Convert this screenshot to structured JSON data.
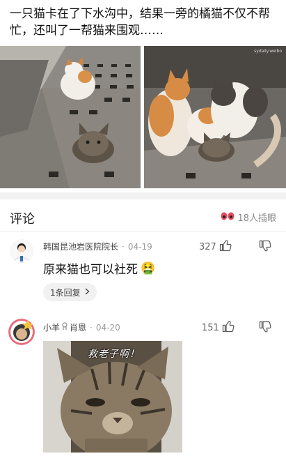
{
  "post": {
    "text": "一只猫卡在了下水沟中，结果一旁的橘猫不仅不帮忙，还叫了一帮猫来围观……",
    "watermark": "sydaily.weibo"
  },
  "comments_section": {
    "title": "评论",
    "views": "18人插眼"
  },
  "comments": [
    {
      "user": "韩国昆池岩医院院长",
      "date": "04-19",
      "likes": "327",
      "text": "原来猫也可以社死",
      "emoji": "🤮",
      "reply_label": "1条回复"
    },
    {
      "user": "小羊",
      "user_suffix": "肖恩",
      "date": "04-20",
      "likes": "151",
      "sticker_caption": "救老子啊！"
    }
  ],
  "colors": {
    "accent_like": "#555555",
    "divider": "#ececec",
    "chip_bg": "#f1f1f1"
  }
}
